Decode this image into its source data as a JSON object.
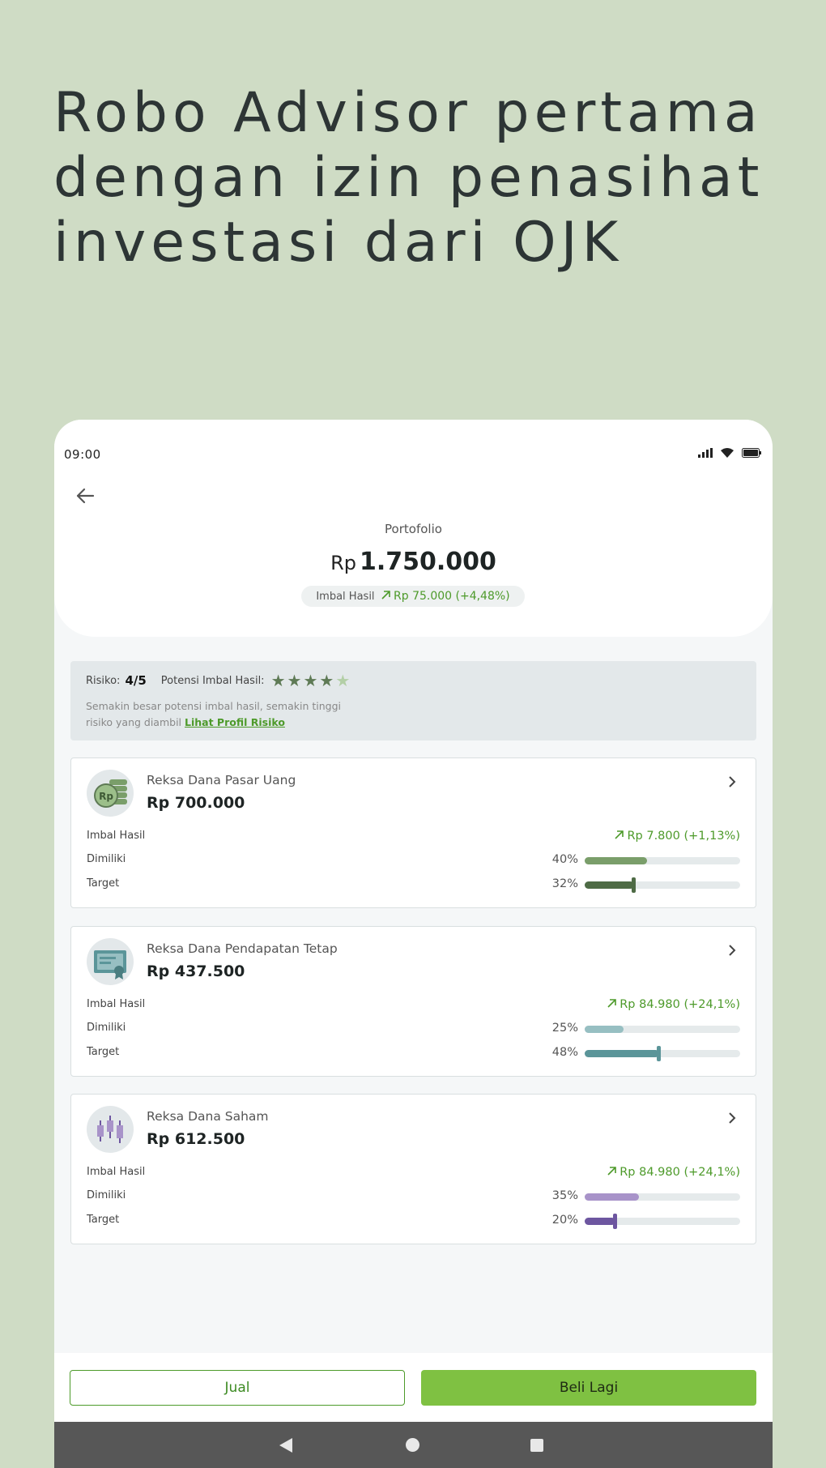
{
  "headline": {
    "line1": "Robo Advisor pertama",
    "line2": "dengan izin penasihat",
    "line3": "investasi dari OJK"
  },
  "status_bar": {
    "time": "09:00",
    "icons": [
      "signal-icon",
      "wifi-icon",
      "battery-icon"
    ]
  },
  "portfolio": {
    "title": "Portofolio",
    "currency": "Rp",
    "value": "1.750.000",
    "return_label": "Imbal Hasil",
    "return_value": "Rp 75.000 (+4,48%)"
  },
  "risk": {
    "label": "Risiko:",
    "value": "4/5",
    "potential_label": "Potensi Imbal Hasil:",
    "stars_filled": 4,
    "stars_total": 5,
    "description": "Semakin besar potensi imbal hasil, semakin tinggi risiko yang diambil",
    "link": "Lihat Profil Risiko"
  },
  "funds": [
    {
      "name": "Reksa Dana Pasar Uang",
      "amount": "Rp 700.000",
      "icon": "money-coins-icon",
      "return_label": "Imbal Hasil",
      "return_value": "Rp 7.800 (+1,13%)",
      "owned_label": "Dimiliki",
      "owned_pct": "40%",
      "owned_value": 40,
      "target_label": "Target",
      "target_pct": "32%",
      "target_value": 32,
      "owned_color": "#7a9e6a",
      "target_color": "#4e6b45"
    },
    {
      "name": "Reksa Dana Pendapatan Tetap",
      "amount": "Rp 437.500",
      "icon": "certificate-icon",
      "return_label": "Imbal Hasil",
      "return_value": "Rp 84.980 (+24,1%)",
      "owned_label": "Dimiliki",
      "owned_pct": "25%",
      "owned_value": 25,
      "target_label": "Target",
      "target_pct": "48%",
      "target_value": 48,
      "owned_color": "#97bfc2",
      "target_color": "#5b9599"
    },
    {
      "name": "Reksa Dana Saham",
      "amount": "Rp 612.500",
      "icon": "candlestick-icon",
      "return_label": "Imbal Hasil",
      "return_value": "Rp 84.980 (+24,1%)",
      "owned_label": "Dimiliki",
      "owned_pct": "35%",
      "owned_value": 35,
      "target_label": "Target",
      "target_pct": "20%",
      "target_value": 20,
      "owned_color": "#a893c9",
      "target_color": "#6d56a0"
    }
  ],
  "actions": {
    "sell": "Jual",
    "buy": "Beli Lagi"
  },
  "colors": {
    "background": "#cfdcc5",
    "accent_green": "#7fc142",
    "return_green": "#4d9a2a"
  }
}
